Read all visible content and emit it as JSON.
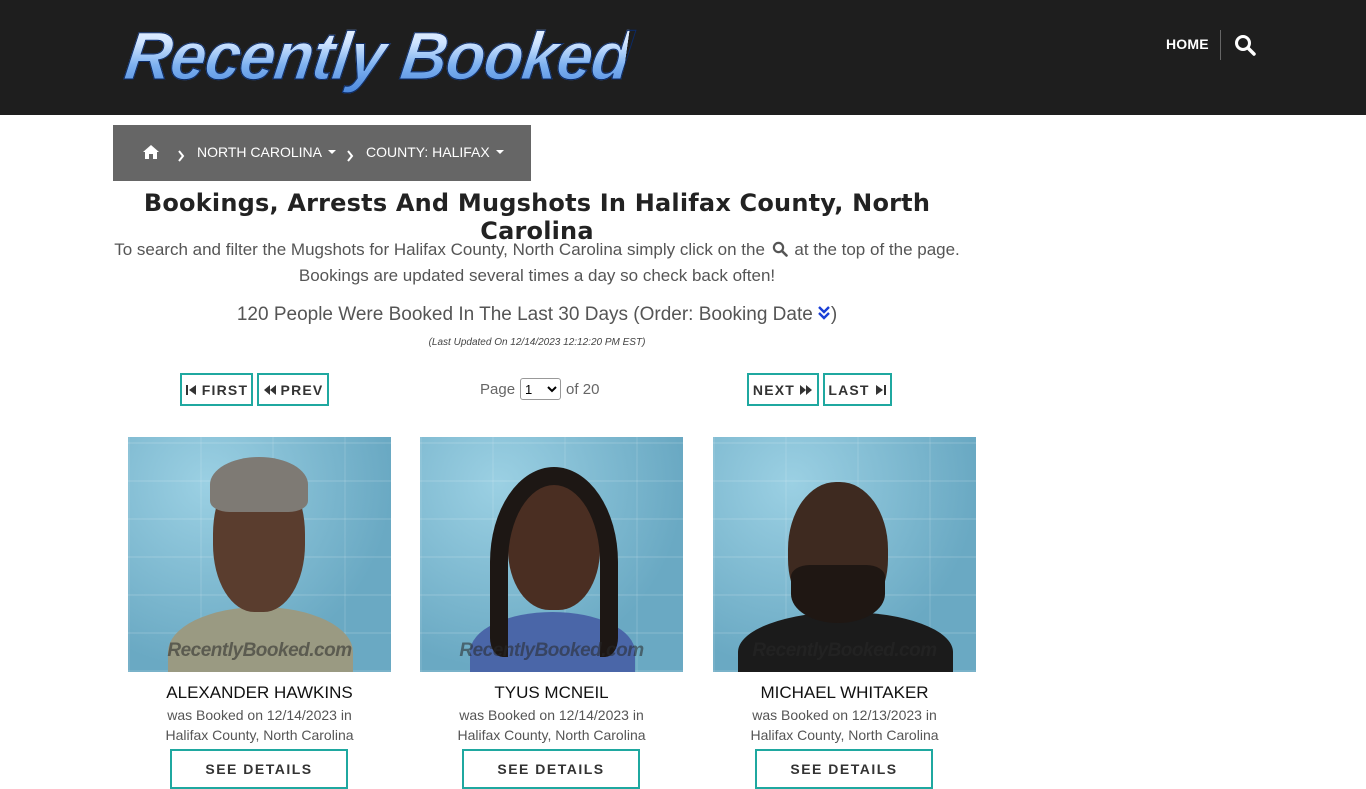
{
  "header": {
    "logo_text": "Recently Booked",
    "nav_home": "HOME",
    "search_icon": "search-icon"
  },
  "breadcrumb": {
    "home_icon": "home-icon",
    "state": "NORTH CAROLINA",
    "county": "COUNTY: HALIFAX"
  },
  "main": {
    "title": "Bookings, Arrests And Mugshots In Halifax County, North Carolina",
    "intro_part1": "To search and filter the Mugshots for Halifax County, North Carolina simply click on the",
    "intro_part2": "at the top of the page.",
    "intro_line2": "Bookings are updated several times a day so check back often!",
    "count_text": "120 People Were Booked In The Last 30 Days (Order: Booking Date",
    "count_close": ")",
    "updated": "(Last Updated On 12/14/2023 12:12:20 PM EST)"
  },
  "pager": {
    "first": "FIRST",
    "prev": "PREV",
    "next": "NEXT",
    "last": "LAST",
    "page_label": "Page",
    "current_page": "1",
    "of_label": "of 20"
  },
  "cards": [
    {
      "name": "ALEXANDER HAWKINS",
      "booked_line": "was Booked on 12/14/2023 in",
      "location": "Halifax County, North Carolina",
      "watermark": "RecentlyBooked.com",
      "button": "SEE DETAILS"
    },
    {
      "name": "TYUS MCNEIL",
      "booked_line": "was Booked on 12/14/2023 in",
      "location": "Halifax County, North Carolina",
      "watermark": "RecentlyBooked.com",
      "button": "SEE DETAILS"
    },
    {
      "name": "MICHAEL WHITAKER",
      "booked_line": "was Booked on 12/13/2023 in",
      "location": "Halifax County, North Carolina",
      "watermark": "RecentlyBooked.com",
      "button": "SEE DETAILS"
    }
  ],
  "colors": {
    "header_bg": "#1e1e1e",
    "breadcrumb_bg": "#666666",
    "accent_teal": "#1fa8a0",
    "sort_icon_blue": "#1a3fd6"
  }
}
